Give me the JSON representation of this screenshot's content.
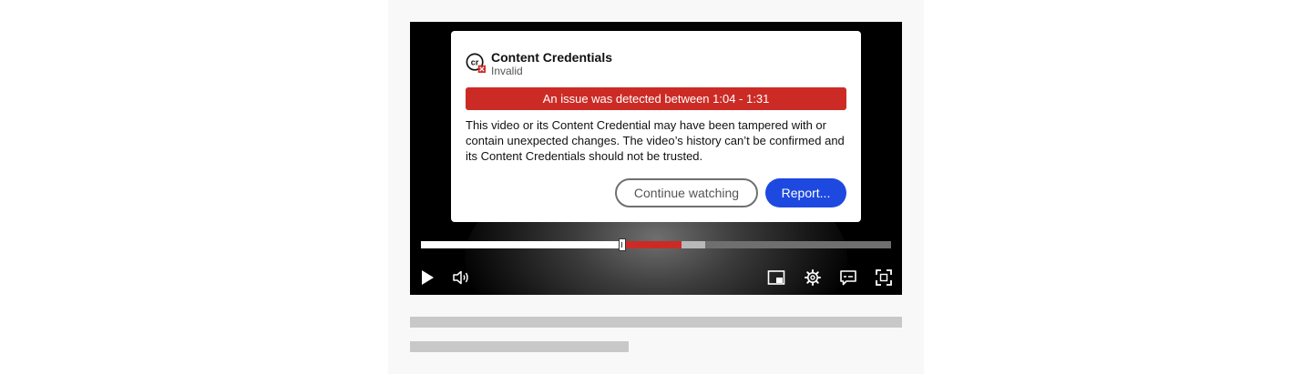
{
  "popup": {
    "title": "Content Credentials",
    "status": "Invalid",
    "alert": "An issue was detected between 1:04 - 1:31",
    "description": "This video or its Content Credential may have been tampered with or contain unexpected changes. The video’s history can’t be confirmed and its Content Credentials should not be trusted.",
    "logo_text": "cr",
    "continue_label": "Continue watching",
    "report_label": "Report..."
  },
  "progress": {
    "played_fraction": 0.42,
    "issue_start_fraction": 0.43,
    "issue_end_fraction": 0.555,
    "buffered_end_fraction": 0.605
  },
  "controls": {
    "left": [
      "play-icon",
      "volume-icon"
    ],
    "right": [
      "picture-in-picture-icon",
      "settings-gear-icon",
      "captions-icon",
      "fullscreen-icon"
    ]
  },
  "colors": {
    "alert": "#cc2b25",
    "primary": "#1d49e0",
    "placeholder": "#c8c8c8"
  }
}
